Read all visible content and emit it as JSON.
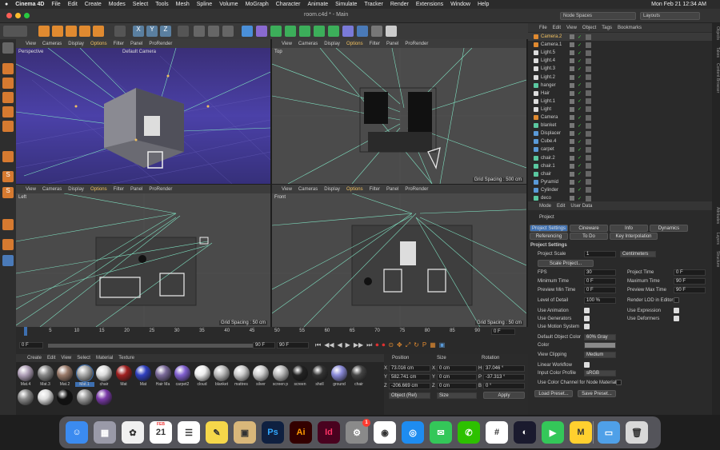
{
  "menubar": {
    "app": "Cinema 4D",
    "items": [
      "File",
      "Edit",
      "Create",
      "Modes",
      "Select",
      "Tools",
      "Mesh",
      "Spline",
      "Volume",
      "MoGraph",
      "Character",
      "Animate",
      "Simulate",
      "Tracker",
      "Render",
      "Extensions",
      "Window",
      "Help"
    ],
    "clock": "Mon Feb 21  12:34 AM"
  },
  "window": {
    "title": "room.c4d * - Main",
    "node_spaces": "Node Spaces",
    "layouts": "Layouts"
  },
  "viewport_menu": [
    "View",
    "Cameras",
    "Display",
    "Options",
    "Filter",
    "Panel",
    "ProRender"
  ],
  "viewports": [
    {
      "name": "Perspective",
      "camera": "Default Camera",
      "grid": ""
    },
    {
      "name": "Top",
      "camera": "",
      "grid": "Grid Spacing : 500 cm"
    },
    {
      "name": "Left",
      "camera": "",
      "grid": "Grid Spacing : 50 cm"
    },
    {
      "name": "Front",
      "camera": "",
      "grid": "Grid Spacing : 50 cm"
    }
  ],
  "objects": {
    "menu": [
      "File",
      "Edit",
      "View",
      "Object",
      "Tags",
      "Bookmarks"
    ],
    "rows": [
      "Camera.2",
      "Camera.1",
      "Light.5",
      "Light.4",
      "Light.3",
      "Light.2",
      "hanger",
      "Hair",
      "Light.1",
      "Light",
      "Camera",
      "blanket",
      "Displacer",
      "Cube.4",
      "carpet",
      "chair.2",
      "chair.1",
      "chair",
      "Pyramid",
      "Cylinder",
      "deco"
    ]
  },
  "attributes": {
    "menu": [
      "Mode",
      "Edit",
      "User Data"
    ],
    "title": "Project",
    "tabs": [
      "Project Settings",
      "Cineware",
      "Info",
      "Dynamics",
      "Referencing",
      "To Do",
      "Key Interpolation"
    ],
    "section": "Project Settings",
    "project_scale_label": "Project Scale",
    "project_scale": "1",
    "scale_unit": "Centimeters",
    "scale_btn": "Scale Project...",
    "fps_label": "FPS",
    "fps": "30",
    "project_time_label": "Project Time",
    "project_time": "0 F",
    "min_time_label": "Minimum Time",
    "min_time": "0 F",
    "max_time_label": "Maximum Time",
    "max_time": "90 F",
    "prev_min_label": "Preview Min Time",
    "prev_min": "0 F",
    "prev_max_label": "Preview Max Time",
    "prev_max": "90 F",
    "lod_label": "Level of Detail",
    "lod": "100 %",
    "render_lod": "Render LOD in Editor",
    "use_anim": "Use Animation",
    "use_expr": "Use Expression",
    "use_gen": "Use Generators",
    "use_def": "Use Deformers",
    "use_motion": "Use Motion System",
    "def_color_label": "Default Object Color",
    "def_color": "60% Gray",
    "color_label": "Color",
    "clipping_label": "View Clipping",
    "clipping": "Medium",
    "linear_label": "Linear Workflow",
    "profile_label": "Input Color Profile",
    "profile": "sRGB",
    "node_color": "Use Color Channel for Node Material",
    "load_preset": "Load Preset...",
    "save_preset": "Save Preset..."
  },
  "side_tabs_top": [
    "Objects",
    "Takes",
    "Content Browser"
  ],
  "side_tabs_bottom": [
    "Attributes",
    "Layers",
    "Structure"
  ],
  "timeline": {
    "ticks": [
      "0",
      "5",
      "10",
      "15",
      "20",
      "25",
      "30",
      "35",
      "40",
      "45",
      "50",
      "55",
      "60",
      "65",
      "70",
      "75",
      "80",
      "85",
      "90"
    ],
    "current": "0 F",
    "start": "0 F",
    "end": "90 F",
    "end2": "90 F",
    "frame": "0 F"
  },
  "materials": {
    "menu": [
      "Create",
      "Edit",
      "View",
      "Select",
      "Material",
      "Texture"
    ],
    "row1": [
      "Mat.4",
      "Mat.3",
      "Mat.2",
      "Mat.1",
      "chair",
      "Mat",
      "Mat",
      "Hair Ma",
      "carpet2",
      "cloud",
      "blanket",
      "mattres",
      "silver",
      "screen p",
      "screen",
      "shell",
      "ground",
      "chair"
    ]
  },
  "coords": {
    "headers": [
      "Position",
      "Size",
      "Rotation"
    ],
    "x": "73.016 cm",
    "y": "582.741 cm",
    "z": "-206.669 cm",
    "sx": "0 cm",
    "sy": "0 cm",
    "sz": "0 cm",
    "h": "37.046 °",
    "p": "-37.313 °",
    "b": "0 °",
    "mode": "Object (Rel)",
    "size_mode": "Size",
    "apply": "Apply"
  },
  "dock": [
    {
      "name": "Finder",
      "color": "#3b8bf0",
      "glyph": "☺"
    },
    {
      "name": "Launchpad",
      "color": "#9a9aa8",
      "glyph": "▦"
    },
    {
      "name": "Photos",
      "color": "#f0f0f0",
      "glyph": "✿"
    },
    {
      "name": "Calendar",
      "color": "#ffffff",
      "glyph": "21"
    },
    {
      "name": "Reminders",
      "color": "#ffffff",
      "glyph": "☰"
    },
    {
      "name": "Notes",
      "color": "#f5d74a",
      "glyph": "✎"
    },
    {
      "name": "Preview",
      "color": "#d9b77a",
      "glyph": "▣"
    },
    {
      "name": "Photoshop",
      "color": "#0f2040",
      "glyph": "Ps"
    },
    {
      "name": "Illustrator",
      "color": "#330000",
      "glyph": "Ai"
    },
    {
      "name": "InDesign",
      "color": "#49021f",
      "glyph": "Id"
    },
    {
      "name": "System Preferences",
      "color": "#8a8a8a",
      "glyph": "⚙"
    },
    {
      "name": "Chrome",
      "color": "#ffffff",
      "glyph": "◉"
    },
    {
      "name": "Safari",
      "color": "#1e8cf0",
      "glyph": "◎"
    },
    {
      "name": "Messages",
      "color": "#34c759",
      "glyph": "✉"
    },
    {
      "name": "WeChat",
      "color": "#2dc100",
      "glyph": "✆"
    },
    {
      "name": "Slack",
      "color": "#ffffff",
      "glyph": "#"
    },
    {
      "name": "Cinema 4D",
      "color": "#1a1a2e",
      "glyph": "◐"
    },
    {
      "name": "FaceTime",
      "color": "#34c759",
      "glyph": "▶"
    },
    {
      "name": "Miro",
      "color": "#ffd02f",
      "glyph": "M"
    },
    {
      "name": "Folder",
      "color": "#4fa0e8",
      "glyph": "▭"
    },
    {
      "name": "Trash",
      "color": "#d8d8d8",
      "glyph": "🗑"
    }
  ],
  "dock_badge": "1",
  "calendar_month": "FEB"
}
